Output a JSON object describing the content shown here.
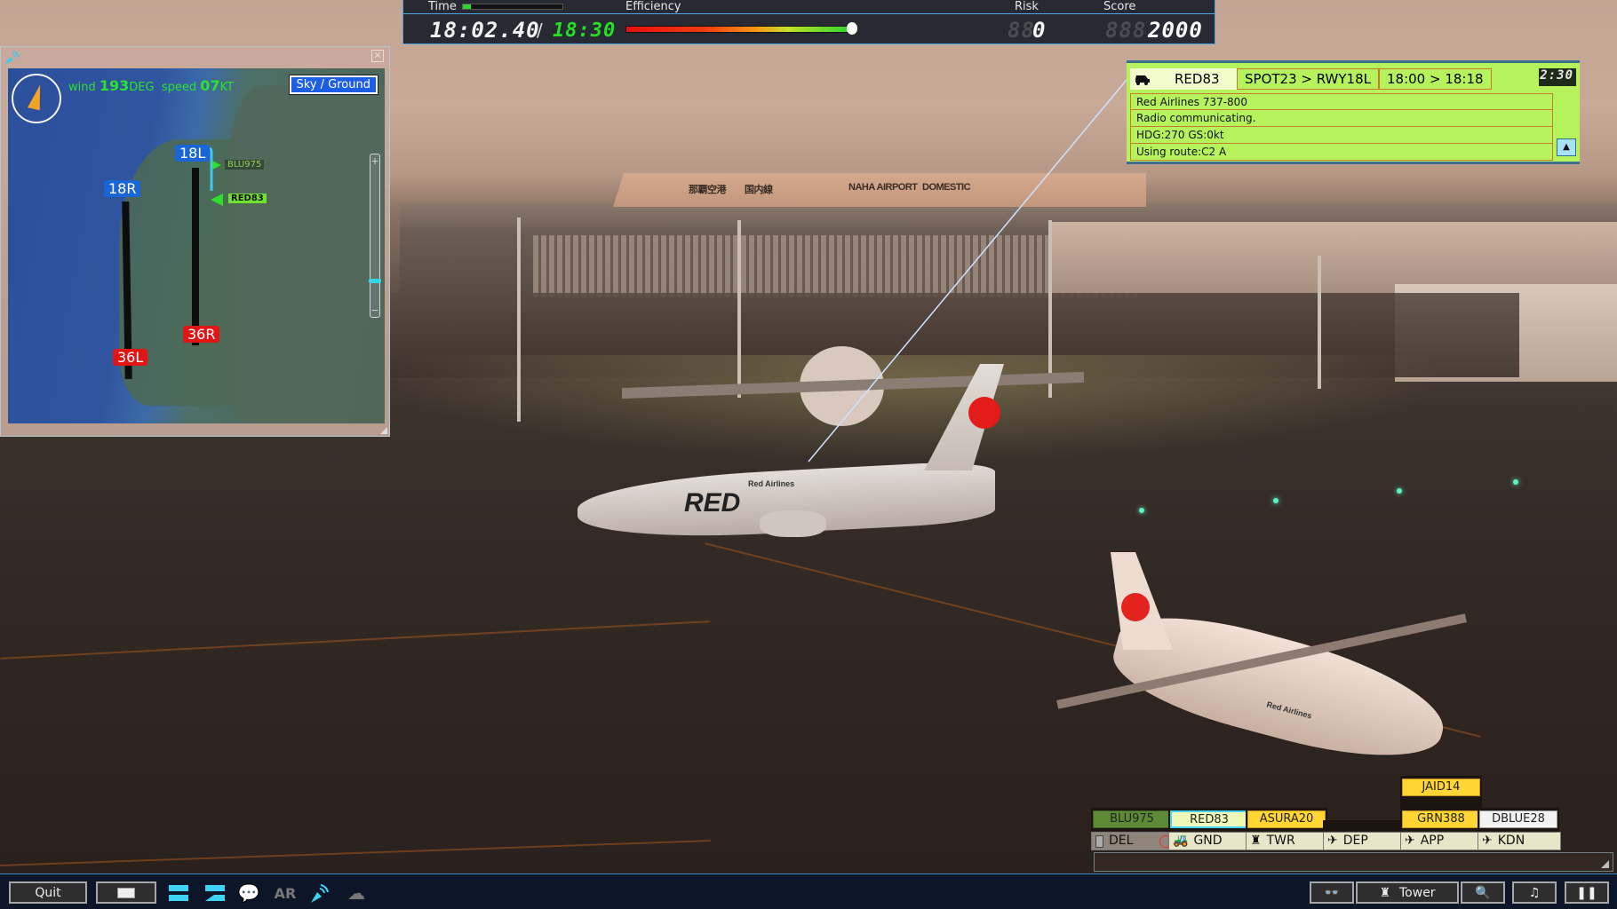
{
  "topbar": {
    "time_label": "Time",
    "time_progress": 0.08,
    "time_current": "18:02.40",
    "time_sep": "/",
    "time_end": "18:30",
    "efficiency_label": "Efficiency",
    "efficiency_value": 1.0,
    "risk_label": "Risk",
    "risk_ghost": "88",
    "risk_value": "0",
    "score_label": "Score",
    "score_ghost": "888",
    "score_value": "2000"
  },
  "minimap": {
    "close_glyph": "✕",
    "wind_label": "wind",
    "wind_dir": "193",
    "wind_dir_unit": "DEG",
    "speed_label": "speed",
    "wind_speed": "07",
    "speed_unit": "KT",
    "mode_button": "Sky / Ground",
    "zoom_plus": "+",
    "zoom_minus": "−",
    "zoom_level": 0.15,
    "runways": [
      {
        "label": "18L",
        "color": "blue"
      },
      {
        "label": "18R",
        "color": "blue"
      },
      {
        "label": "36R",
        "color": "red"
      },
      {
        "label": "36L",
        "color": "red"
      }
    ],
    "aircraft": [
      {
        "callsign": "BLU975"
      },
      {
        "callsign": "RED83"
      }
    ]
  },
  "flight_panel": {
    "icon": "ground-vehicle-icon",
    "callsign": "RED83",
    "route": "SPOT23 > RWY18L",
    "times": "18:00 > 18:18",
    "timer": "2:30",
    "lines": [
      "Red Airlines 737-800",
      "Radio communicating.",
      "HDG:270 GS:0kt",
      "Using route:C2 A"
    ],
    "scroll_up_glyph": "▲"
  },
  "scene": {
    "sign_1": "那覇空港",
    "sign_2": "国内線",
    "sign_3": "NAHA AIRPORT",
    "sign_4": "DOMESTIC",
    "plane_1_livery": "RED",
    "plane_1_airline": "Red Airlines",
    "plane_2_airline": "Red Airlines"
  },
  "strip_bay": {
    "columns": [
      {
        "freq": "DEL",
        "icon": "clipboard-icon",
        "strips": [
          "BLU975"
        ],
        "strip_color": "#5f8a35"
      },
      {
        "freq": "GND",
        "icon": "ground-vehicle-icon",
        "strips": [
          "RED83"
        ],
        "strip_color": "#eef8b8"
      },
      {
        "freq": "TWR",
        "icon": "tower-icon",
        "strips": [
          "ASURA20"
        ],
        "strip_color": "#ffd633"
      },
      {
        "freq": "DEP",
        "icon": "departure-icon",
        "strips": [],
        "strip_color": ""
      },
      {
        "freq": "APP",
        "icon": "arrival-icon",
        "strips": [
          "GRN388",
          "JAID14"
        ],
        "strip_color": "#ffd633"
      },
      {
        "freq": "KDN",
        "icon": "fighter-jet-icon",
        "strips": [
          "DBLUE28"
        ],
        "strip_color": "#f2f2f2"
      }
    ]
  },
  "toolbar": {
    "quit_label": "Quit",
    "ar_label": "AR",
    "view_label": "Tower",
    "colors": {
      "accent": "#3ed3f5",
      "bg": "#0c1628"
    }
  }
}
